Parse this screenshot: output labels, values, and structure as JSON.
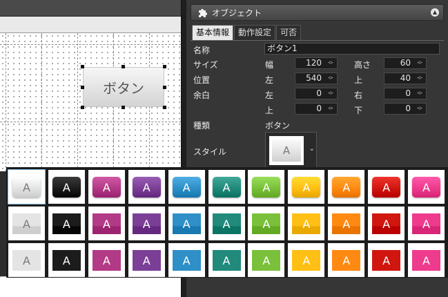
{
  "panel": {
    "title": "オブジェクト",
    "tabs": [
      "基本情報",
      "動作設定",
      "可否"
    ],
    "name_label": "名称",
    "name_value": "ボタン1",
    "size_label": "サイズ",
    "width_label": "幅",
    "width_value": "120",
    "height_label": "高さ",
    "height_value": "60",
    "position_label": "位置",
    "left_label": "左",
    "left_value": "540",
    "top_label": "上",
    "top_value": "40",
    "margin_label": "余白",
    "margin_left_label": "左",
    "margin_left_value": "0",
    "margin_right_label": "右",
    "margin_right_value": "0",
    "margin_top_label": "上",
    "margin_top_value": "0",
    "margin_bottom_label": "下",
    "margin_bottom_value": "0",
    "type_label": "種類",
    "type_value": "ボタン",
    "style_label": "スタイル",
    "style_preview": "A"
  },
  "canvas": {
    "button_text": "ボタン"
  },
  "styles": {
    "glyph": "A",
    "selected_index": 0,
    "colors": [
      "#e4e4e4",
      "#1c1c1c",
      "#b23a86",
      "#7b3f97",
      "#2f8fc7",
      "#218a7b",
      "#7ac03a",
      "#ffbf14",
      "#ff8a12",
      "#d0160f",
      "#ee3b8d"
    ],
    "text_colors": [
      "#7a7a7a",
      "#ffffff",
      "#ffffff",
      "#ffffff",
      "#ffffff",
      "#ffffff",
      "#ffffff",
      "#ffffff",
      "#ffffff",
      "#ffffff",
      "#ffffff"
    ]
  }
}
